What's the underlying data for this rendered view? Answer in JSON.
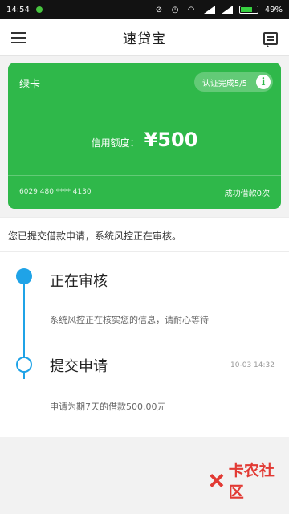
{
  "status_bar": {
    "time": "14:54",
    "battery_percent": "49%"
  },
  "header": {
    "title": "速贷宝"
  },
  "card": {
    "type_label": "绿卡",
    "verify_text": "认证完成5/5",
    "credit_label": "信用额度：",
    "credit_amount": "¥500",
    "card_number": "6029 480 **** 4130",
    "loan_count_text": "成功借款0次"
  },
  "notice": {
    "text": "您已提交借款申请，系统风控正在审核。"
  },
  "timeline": {
    "steps": [
      {
        "title": "正在审核",
        "desc": "系统风控正在核实您的信息，请耐心等待",
        "time": ""
      },
      {
        "title": "提交申请",
        "desc": "申请为期7天的借款500.00元",
        "time": "10-03 14:32"
      }
    ]
  },
  "watermark": {
    "text": "卡农社区"
  },
  "colors": {
    "card_green": "#2fb84a",
    "timeline_blue": "#1fa3e7",
    "watermark_red": "#e23a34"
  }
}
